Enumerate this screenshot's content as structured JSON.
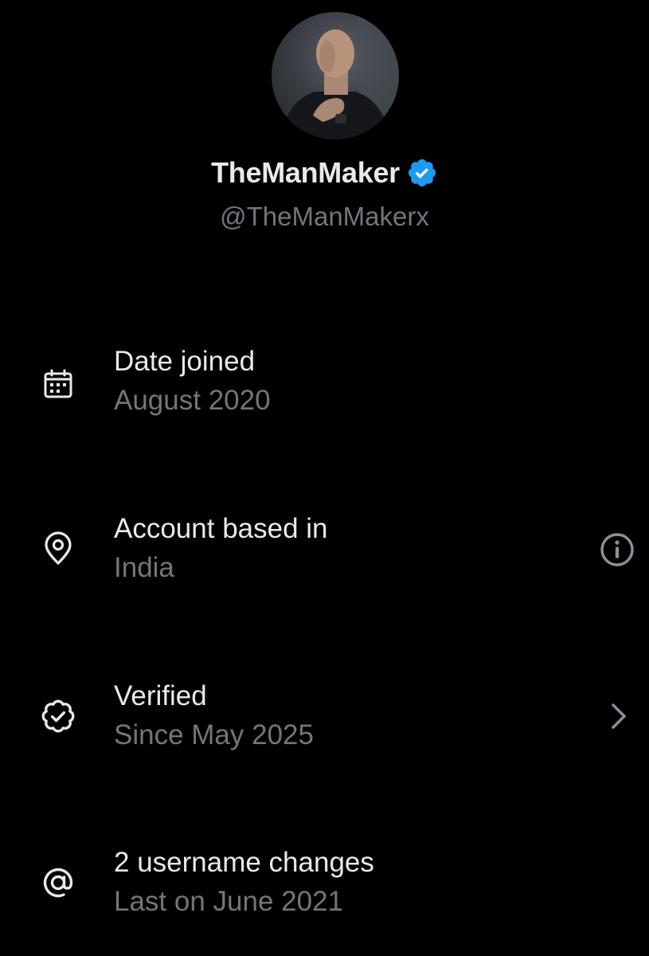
{
  "profile": {
    "display_name": "TheManMaker",
    "handle": "@TheManMakerx",
    "avatar_icon": "profile-photo",
    "verified_badge_icon": "verified-badge-icon",
    "verified_badge_color": "#1d9bf0"
  },
  "rows": [
    {
      "icon": "calendar-icon",
      "title": "Date joined",
      "subtitle": "August 2020"
    },
    {
      "icon": "location-pin-icon",
      "title": "Account based in",
      "subtitle": "India",
      "trailing_icon": "info-icon"
    },
    {
      "icon": "verified-check-icon",
      "title": "Verified",
      "subtitle": "Since May 2025",
      "trailing_icon": "chevron-right-icon"
    },
    {
      "icon": "at-sign-icon",
      "title": "2 username changes",
      "subtitle": "Last on June 2021"
    }
  ],
  "colors": {
    "background": "#000000",
    "primary_text": "#e7e9ea",
    "secondary_text": "#71767b",
    "accent_blue": "#1d9bf0"
  }
}
